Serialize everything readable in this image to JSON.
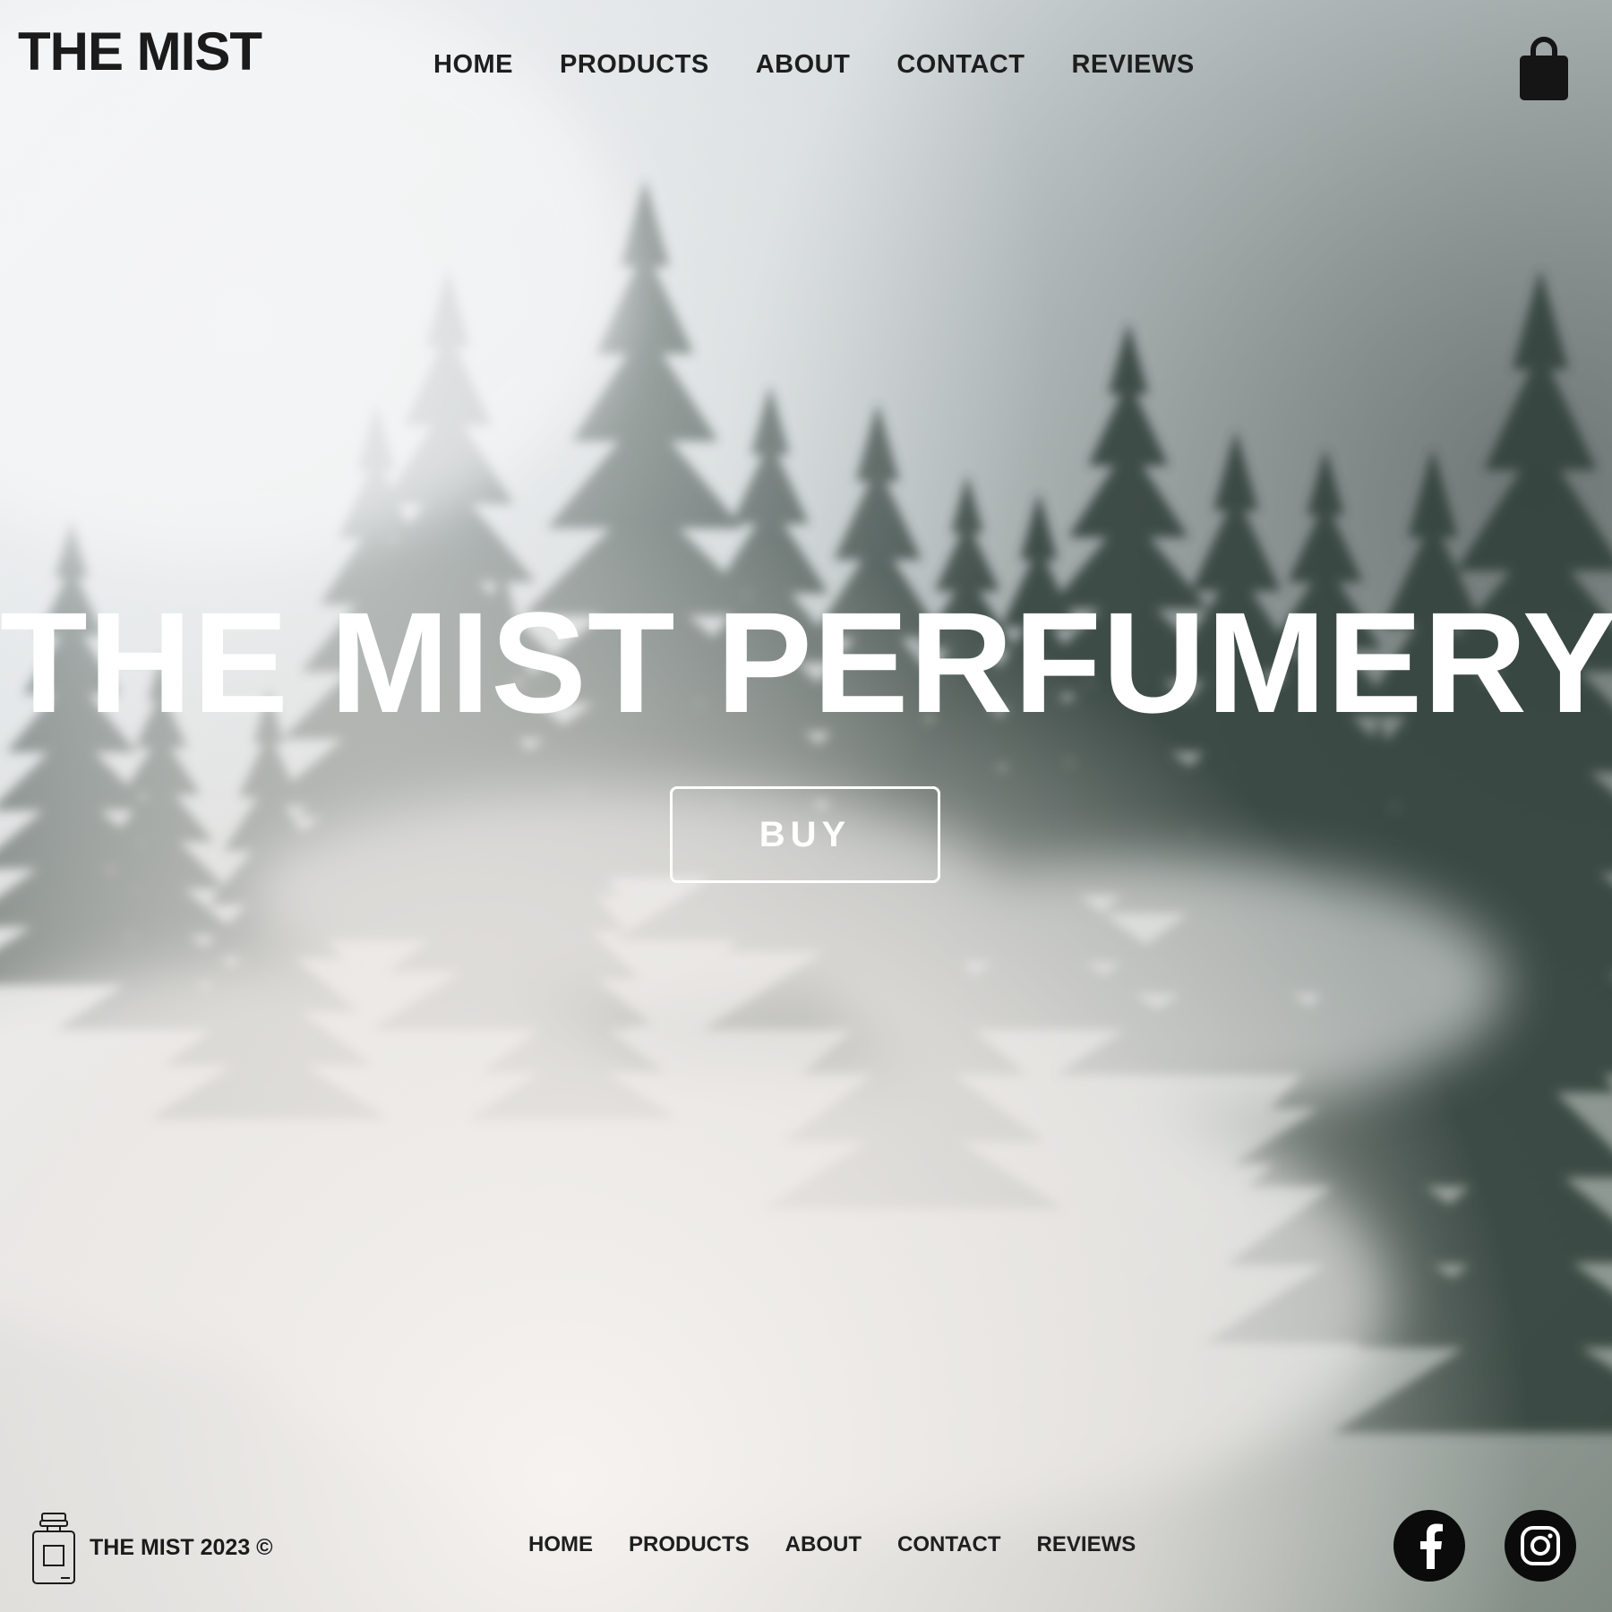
{
  "header": {
    "brand": "THE MIST",
    "nav": [
      "HOME",
      "PRODUCTS",
      "ABOUT",
      "CONTACT",
      "REVIEWS"
    ],
    "cart_icon": "shopping-bag-icon"
  },
  "hero": {
    "title": "THE MIST PERFUMERY",
    "buy_label": "BUY",
    "background": "misty-pine-forest-image"
  },
  "footer": {
    "logo_icon": "perfume-bottle-icon",
    "copyright": "THE MIST 2023 ©",
    "nav": [
      "HOME",
      "PRODUCTS",
      "ABOUT",
      "CONTACT",
      "REVIEWS"
    ],
    "social": [
      "facebook-icon",
      "instagram-icon"
    ]
  },
  "colors": {
    "text_dark": "#1b1b1b",
    "hero_text": "#ffffff",
    "social_bg": "#0b0b0b"
  }
}
